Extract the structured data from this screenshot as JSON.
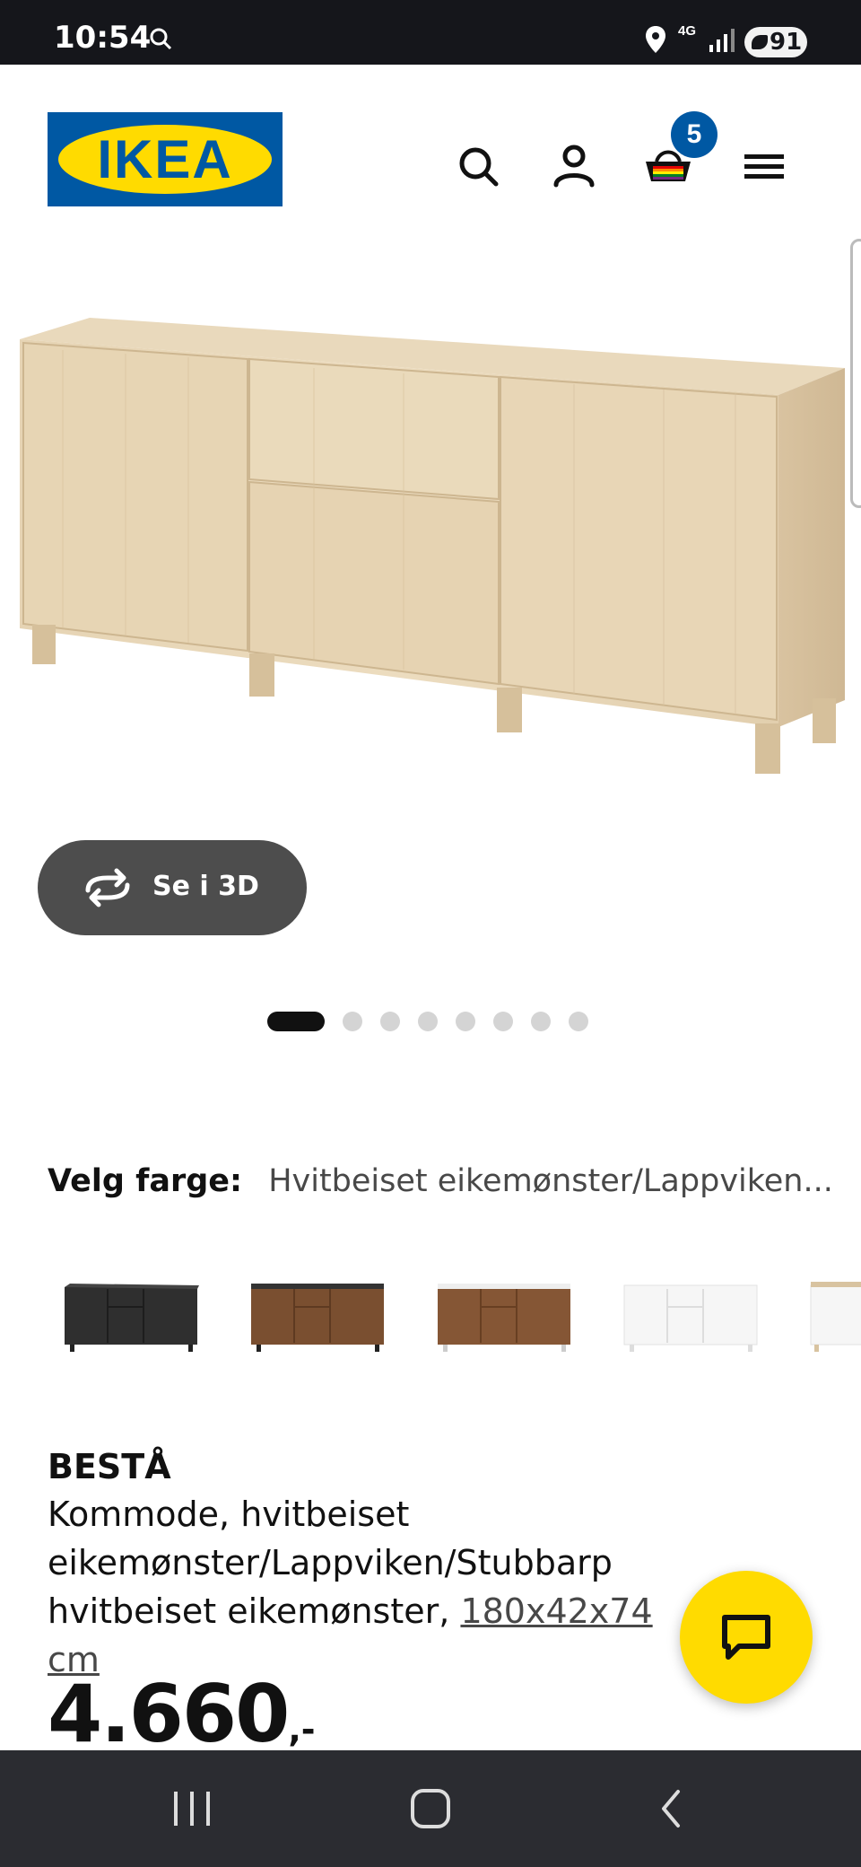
{
  "status_bar": {
    "time": "10:54",
    "network": "4G",
    "battery": "91"
  },
  "header": {
    "logo_text": "IKEA",
    "cart_count": "5",
    "brand_blue": "#0058a3",
    "brand_yellow": "#ffdb00"
  },
  "gallery": {
    "view_3d_label": "Se i 3D",
    "dot_count": 8,
    "active_dot": 1
  },
  "color_selector": {
    "label": "Velg farge:",
    "value": "Hvitbeiset eikemønster/Lappviken..."
  },
  "product": {
    "name": "BESTÅ",
    "description": "Kommode, hvitbeiset eikemønster/Lappviken/Stubbarp hvitbeiset eikemønster,",
    "dimensions": "180x42x74 cm",
    "price": "4.660",
    "price_suffix": ",-"
  }
}
